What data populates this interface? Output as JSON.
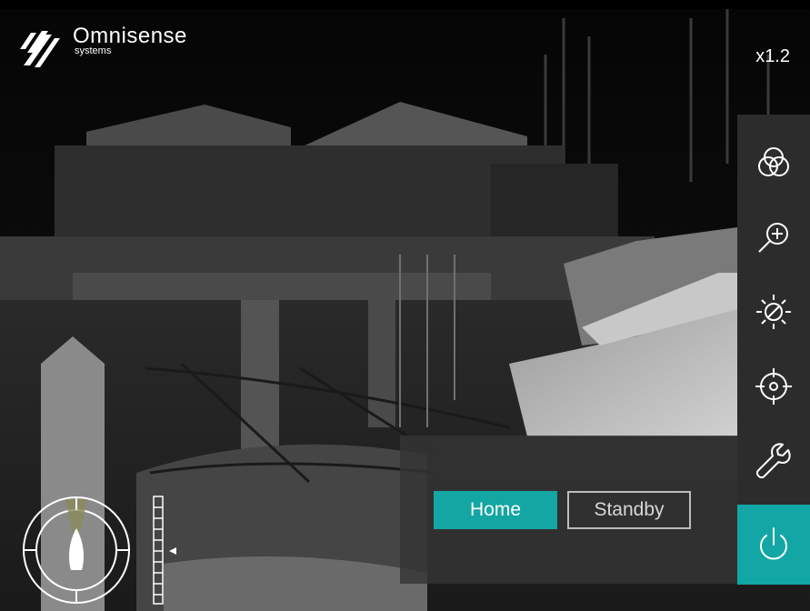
{
  "app": {
    "brand_name": "Omnisense",
    "brand_sub": "systems"
  },
  "camera": {
    "zoom_label": "x1.2"
  },
  "toolbar": {
    "items": [
      {
        "name": "color-palette",
        "icon": "palette-icon"
      },
      {
        "name": "zoom",
        "icon": "zoom-in-icon"
      },
      {
        "name": "brightness",
        "icon": "brightness-icon"
      },
      {
        "name": "target",
        "icon": "crosshair-icon"
      },
      {
        "name": "settings",
        "icon": "wrench-icon"
      },
      {
        "name": "power",
        "icon": "power-icon",
        "active": true
      }
    ]
  },
  "mode_panel": {
    "home_label": "Home",
    "standby_label": "Standby"
  },
  "colors": {
    "accent": "#12a7a4",
    "toolbar_bg": "#2c2c2c",
    "panel_bg": "#343434"
  }
}
